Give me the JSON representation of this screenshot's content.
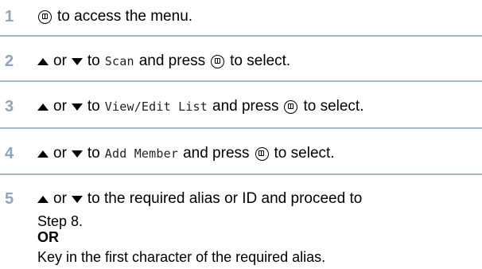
{
  "steps": [
    {
      "number": "1",
      "text_after_key": "to access the menu."
    },
    {
      "number": "2",
      "or": "or",
      "to": "to",
      "item": "Scan",
      "and_press": "and press",
      "to_select": "to select."
    },
    {
      "number": "3",
      "or": "or",
      "to": "to",
      "item": "View/Edit List",
      "and_press": "and press",
      "to_select": "to select."
    },
    {
      "number": "4",
      "or": "or",
      "to": "to",
      "item": "Add Member",
      "and_press": "and press",
      "to_select": "to select."
    },
    {
      "number": "5",
      "or": "or",
      "line1_text": "to the required alias or ID and proceed to",
      "line2_text": "Step 8.",
      "or_heading": "OR",
      "line4_text": "Key in the first character of the required alias."
    }
  ],
  "icons": {
    "menu_key": "menu-select-key-icon",
    "up_key": "up-arrow-key-icon",
    "down_key": "down-arrow-key-icon"
  },
  "colors": {
    "step_number": "#8fa4bd",
    "divider": "#a7b6c7"
  }
}
